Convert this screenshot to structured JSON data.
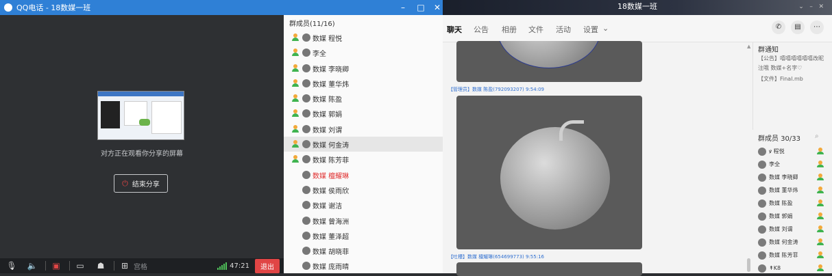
{
  "call_window": {
    "title": "QQ电话 - 18数媒一班",
    "watching_text": "对方正在观看你分享的屏幕",
    "end_share_label": "结束分享",
    "grid_label": "宫格",
    "timer": "47:21",
    "exit_label": "退出"
  },
  "members_panel": {
    "header": "群成员(11/16)",
    "members": [
      {
        "name": "数媒 程悦",
        "prefix": "ꝟ"
      },
      {
        "name": "李全"
      },
      {
        "name": "数媒 李晓卿"
      },
      {
        "name": "数媒 董华炜"
      },
      {
        "name": "数媒 陈盈"
      },
      {
        "name": "数媒 郭娟"
      },
      {
        "name": "数媒 刘谓"
      },
      {
        "name": "数媒 何金涛"
      },
      {
        "name": "数媒 陈芳菲"
      },
      {
        "name": "数媒 檀耀琳"
      },
      {
        "name": "数媒 侯雨欣"
      },
      {
        "name": "数媒 谢洁"
      },
      {
        "name": "数媒 曾海洲"
      },
      {
        "name": "数媒 董泽超"
      },
      {
        "name": "数媒 胡晓菲"
      },
      {
        "name": "数媒 庞雨晴"
      }
    ]
  },
  "chat_window": {
    "title": "18数媒一班",
    "tabs": [
      "聊天",
      "公告",
      "相册",
      "文件",
      "活动",
      "设置"
    ],
    "messages": [
      {
        "sender": "【管理员】数媒 陈盈(792093207) 9:54:09"
      },
      {
        "sender": "【吐槽】数媒 檀耀琳(654699773) 9:55:16"
      }
    ],
    "notice": {
      "title": "群通知",
      "lines": [
        "【公告】嘻嘻嘻嘻嘻嘻改昵",
        "注哦 数媒+名字♡",
        "【文件】Final.mb"
      ]
    },
    "group_members_header": "群成员 30/33",
    "group_members": [
      "ꝟ 程悦",
      "李全",
      "数媒 李晓卿",
      "数媒 董华炜",
      "数媒 陈盈",
      "数媒 郭娟",
      "数媒 刘谓",
      "数媒 何金涛",
      "数媒 陈芳菲",
      "↟K8"
    ]
  },
  "colors": {
    "titlebar_blue": "#2f80d6",
    "exit_red": "#e04545",
    "highlight_red": "#e03030"
  }
}
